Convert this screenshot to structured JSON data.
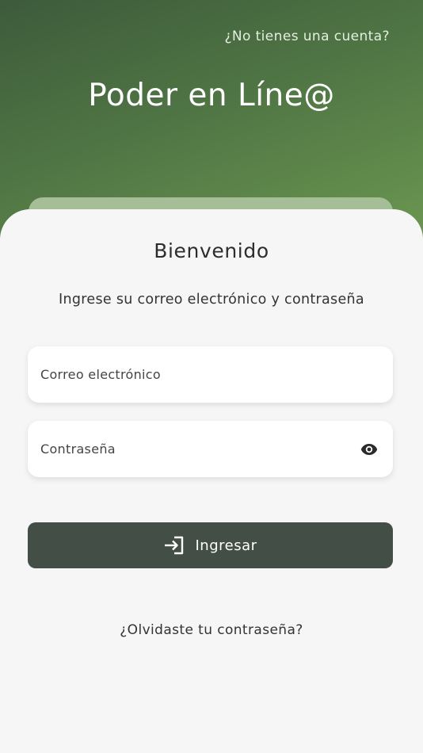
{
  "header": {
    "signup_link": "¿No tienes una cuenta?",
    "app_title": "Poder en Líne@"
  },
  "login": {
    "welcome": "Bienvenido",
    "instruction": "Ingrese su correo electrónico y contraseña",
    "email_placeholder": "Correo electrónico",
    "password_placeholder": "Contraseña",
    "password_toggle_icon": "eye-icon",
    "submit_icon": "login-icon",
    "submit_label": "Ingresar",
    "forgot_link": "¿Olvidaste tu contraseña?"
  },
  "colors": {
    "header_gradient_start": "#3d5b3b",
    "header_gradient_end": "#6a9650",
    "card_background": "#f6f6f6",
    "button_background": "#434e46"
  }
}
